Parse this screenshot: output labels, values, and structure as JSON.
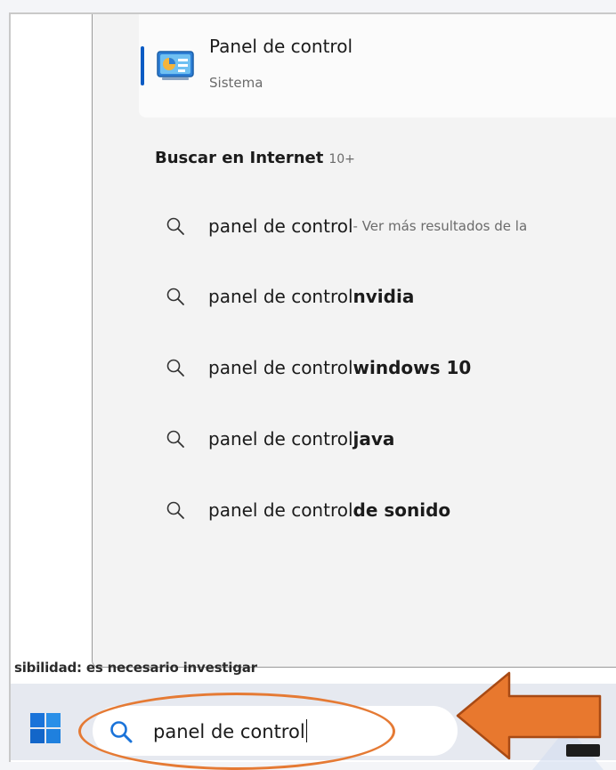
{
  "best_match": {
    "title": "Panel de control",
    "subtitle": "Sistema",
    "icon": "control-panel-icon"
  },
  "web_section": {
    "title": "Buscar en Internet",
    "count": "10+"
  },
  "suggestions": [
    {
      "query": "panel de control",
      "bold": "",
      "extra": " - Ver más resultados de la"
    },
    {
      "query": "panel de control ",
      "bold": "nvidia",
      "extra": ""
    },
    {
      "query": "panel de control ",
      "bold": "windows 10",
      "extra": ""
    },
    {
      "query": "panel de control ",
      "bold": "java",
      "extra": ""
    },
    {
      "query": "panel de control ",
      "bold": "de sonido",
      "extra": ""
    }
  ],
  "status_text": "sibilidad: es necesario investigar",
  "taskbar": {
    "search_value": "panel de control",
    "start_icon": "windows-logo-icon",
    "search_icon": "search-icon"
  },
  "colors": {
    "accent": "#0a5bc4",
    "annotation": "#e57a34",
    "arrow_fill": "#e8782e"
  }
}
